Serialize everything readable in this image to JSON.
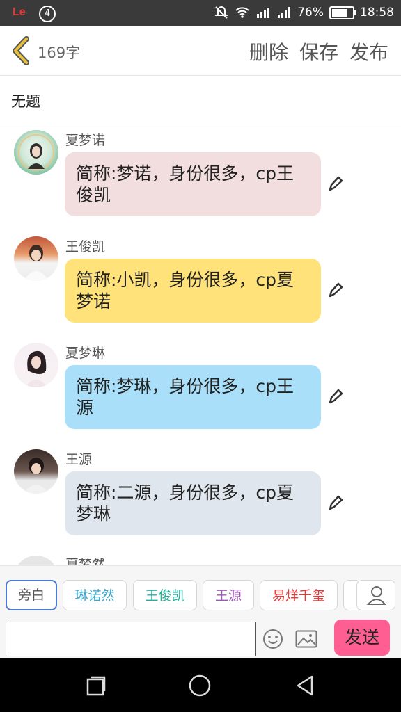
{
  "status_bar": {
    "carrier_logo": "Le",
    "notification_count": "4",
    "battery": "76%",
    "time": "18:58"
  },
  "header": {
    "char_count": "169字",
    "actions": {
      "delete": "删除",
      "save": "保存",
      "publish": "发布"
    }
  },
  "title": "无题",
  "messages": [
    {
      "name": "夏梦诺",
      "text": "简称:梦诺，身份很多，cp王俊凯",
      "bubble_color": "#f3dedf"
    },
    {
      "name": "王俊凯",
      "text": "简称:小凯，身份很多，cp夏梦诺",
      "bubble_color": "#ffe27a"
    },
    {
      "name": "夏梦琳",
      "text": "简称:梦琳，身份很多，cp王源",
      "bubble_color": "#a9dff8"
    },
    {
      "name": "王源",
      "text": "简称:二源，身份很多，cp夏梦琳",
      "bubble_color": "#dfe6ee"
    },
    {
      "name": "夏梦然"
    }
  ],
  "character_chips": [
    {
      "label": "旁白",
      "color": "#555555"
    },
    {
      "label": "琳诺然",
      "color": "#3aa4c8"
    },
    {
      "label": "王俊凯",
      "color": "#27b09a"
    },
    {
      "label": "王源",
      "color": "#9b59b6"
    },
    {
      "label": "易烊千玺",
      "color": "#e53935"
    }
  ],
  "input": {
    "value": "",
    "send_label": "发送"
  },
  "colors": {
    "accent_send": "#ff5e92",
    "selected_chip_border": "#4a7bd0",
    "back_arrow": "#e8c23c"
  }
}
